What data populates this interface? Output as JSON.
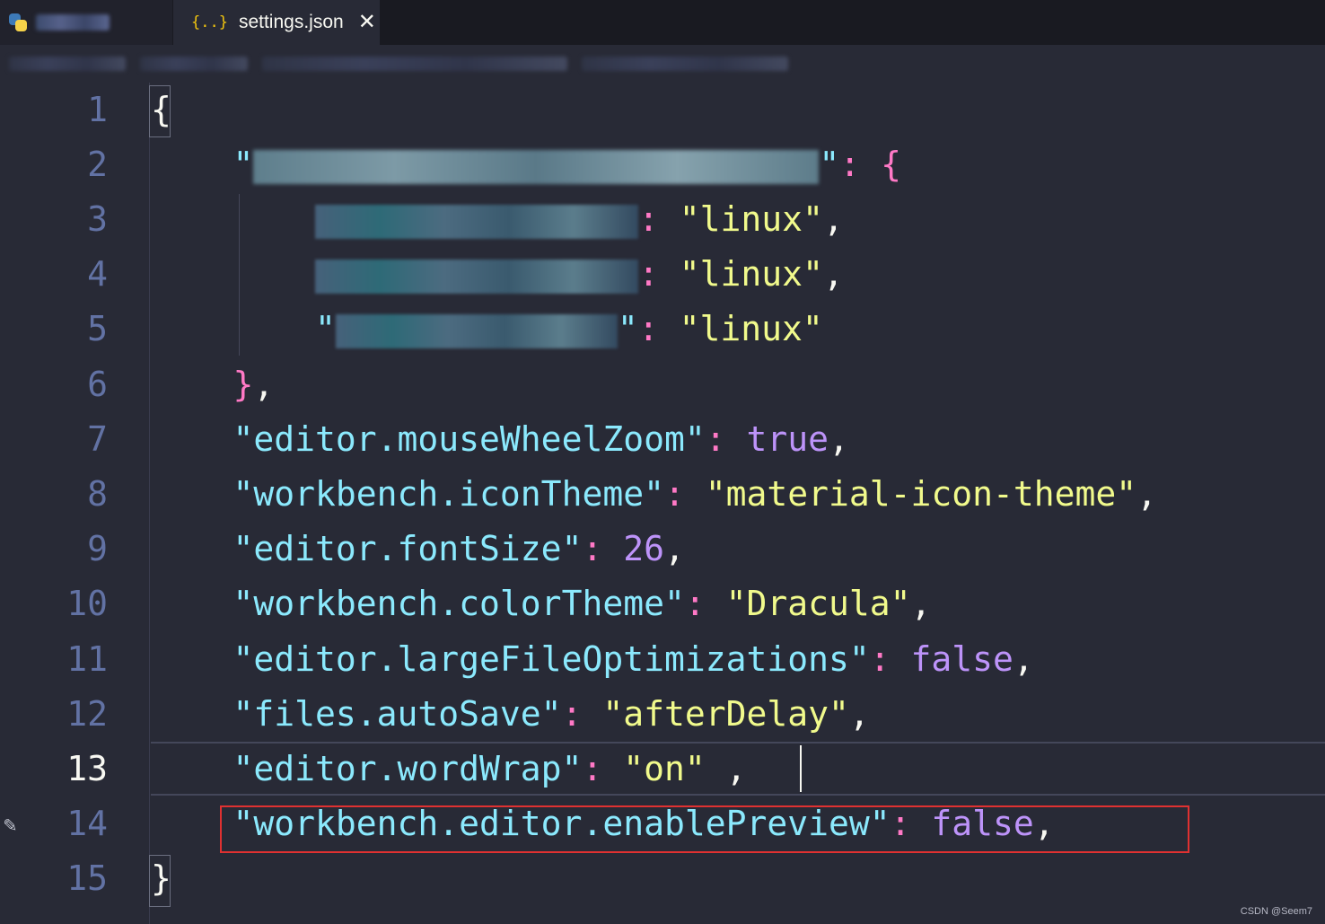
{
  "tabs": {
    "inactive": {
      "label": "Test..."
    },
    "active": {
      "icon_text": "{..}",
      "label": "settings.json",
      "close": "✕"
    }
  },
  "breadcrumb": {
    "visible_text": ""
  },
  "line_numbers": [
    "1",
    "2",
    "3",
    "4",
    "5",
    "6",
    "7",
    "8",
    "9",
    "10",
    "11",
    "12",
    "13",
    "14",
    "15"
  ],
  "active_line": "13",
  "code": {
    "l1": "{",
    "l2_q": "\"",
    "l2_q2": "\"",
    "l2_colon": ": ",
    "l2_brace": "{",
    "l3_colon": ": ",
    "l3_val": "\"linux\"",
    "l3_comma": ",",
    "l4_colon": ": ",
    "l4_val": "\"linux\"",
    "l4_comma": ",",
    "l5_q": "\"",
    "l5_q2": "\"",
    "l5_colon": ": ",
    "l5_val": "\"linux\"",
    "l6_brace": "}",
    "l6_comma": ",",
    "l7_key": "\"editor.mouseWheelZoom\"",
    "l7_colon": ": ",
    "l7_val": "true",
    "l7_comma": ",",
    "l8_key": "\"workbench.iconTheme\"",
    "l8_colon": ": ",
    "l8_val": "\"material-icon-theme\"",
    "l8_comma": ",",
    "l9_key": "\"editor.fontSize\"",
    "l9_colon": ": ",
    "l9_val": "26",
    "l9_comma": ",",
    "l10_key": "\"workbench.colorTheme\"",
    "l10_colon": ": ",
    "l10_val": "\"Dracula\"",
    "l10_comma": ",",
    "l11_key": "\"editor.largeFileOptimizations\"",
    "l11_colon": ": ",
    "l11_val": "false",
    "l11_comma": ",",
    "l12_key": "\"files.autoSave\"",
    "l12_colon": ": ",
    "l12_val": "\"afterDelay\"",
    "l12_comma": ",",
    "l13_key": "\"editor.wordWrap\"",
    "l13_colon": ": ",
    "l13_val": "\"on\"",
    "l13_comma": " ,",
    "l14_key": "\"workbench.editor.enablePreview\"",
    "l14_colon": ": ",
    "l14_val": "false",
    "l14_comma": ",",
    "l15": "}"
  },
  "watermark": "CSDN @Seem7",
  "colors": {
    "background": "#282a36",
    "string": "#f1fa8c",
    "key": "#8be9fd",
    "punctuation": "#ff79c6",
    "boolean_number": "#bd93f9",
    "highlight_box": "#e03131"
  }
}
